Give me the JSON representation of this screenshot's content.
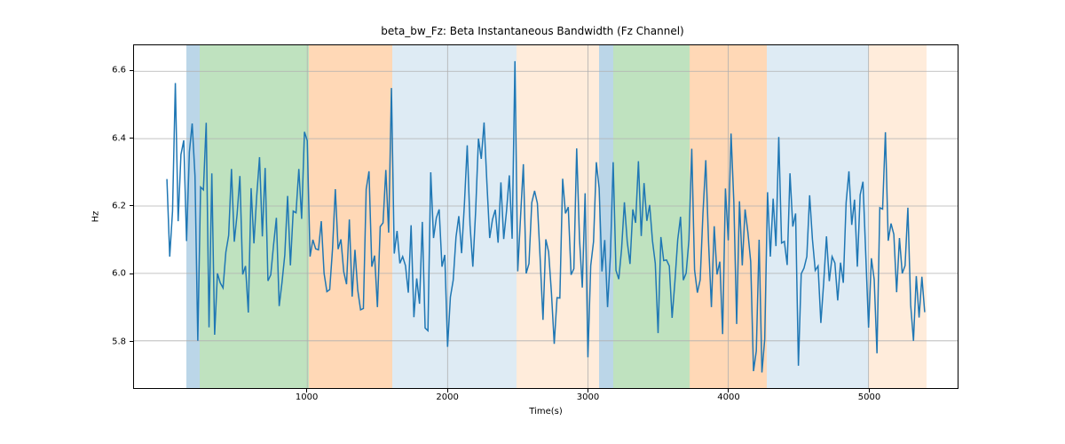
{
  "chart_data": {
    "type": "line",
    "title": "beta_bw_Fz: Beta Instantaneous Bandwidth (Fz Channel)",
    "xlabel": "Time(s)",
    "ylabel": "Hz",
    "xlim": [
      -234.5,
      5634.5
    ],
    "ylim": [
      5.6598,
      6.677
    ],
    "xticks": [
      1000,
      2000,
      3000,
      4000,
      5000
    ],
    "yticks": [
      5.8,
      6.0,
      6.2,
      6.4,
      6.6
    ],
    "spans": [
      {
        "x0": 140,
        "x1": 232,
        "color": "#1f77b4",
        "alpha": 0.3
      },
      {
        "x0": 232,
        "x1": 1008,
        "color": "#2ca02c",
        "alpha": 0.3
      },
      {
        "x0": 1008,
        "x1": 1604,
        "color": "#ff7f0e",
        "alpha": 0.3
      },
      {
        "x0": 1604,
        "x1": 2484,
        "color": "#1f77b4",
        "alpha": 0.15
      },
      {
        "x0": 2484,
        "x1": 3072,
        "color": "#ff7f0e",
        "alpha": 0.15
      },
      {
        "x0": 3072,
        "x1": 3176,
        "color": "#1f77b4",
        "alpha": 0.3
      },
      {
        "x0": 3176,
        "x1": 3716,
        "color": "#2ca02c",
        "alpha": 0.3
      },
      {
        "x0": 3716,
        "x1": 4264,
        "color": "#ff7f0e",
        "alpha": 0.3
      },
      {
        "x0": 4264,
        "x1": 4988,
        "color": "#1f77b4",
        "alpha": 0.15
      },
      {
        "x0": 4988,
        "x1": 5400,
        "color": "#ff7f0e",
        "alpha": 0.15
      }
    ],
    "x": [
      0,
      20,
      40,
      60,
      80,
      100,
      120,
      140,
      160,
      180,
      200,
      220,
      240,
      260,
      280,
      300,
      320,
      340,
      360,
      380,
      400,
      420,
      440,
      460,
      480,
      500,
      520,
      540,
      560,
      580,
      600,
      620,
      640,
      660,
      680,
      700,
      720,
      740,
      760,
      780,
      800,
      820,
      840,
      860,
      880,
      900,
      920,
      940,
      960,
      980,
      1000,
      1020,
      1040,
      1060,
      1080,
      1100,
      1120,
      1140,
      1160,
      1180,
      1200,
      1220,
      1240,
      1260,
      1280,
      1300,
      1320,
      1340,
      1360,
      1380,
      1400,
      1420,
      1440,
      1460,
      1480,
      1500,
      1520,
      1540,
      1560,
      1580,
      1600,
      1620,
      1640,
      1660,
      1680,
      1700,
      1720,
      1740,
      1760,
      1780,
      1800,
      1820,
      1840,
      1860,
      1880,
      1900,
      1920,
      1940,
      1960,
      1980,
      2000,
      2020,
      2040,
      2060,
      2080,
      2100,
      2120,
      2140,
      2160,
      2180,
      2200,
      2220,
      2240,
      2260,
      2280,
      2300,
      2320,
      2340,
      2360,
      2380,
      2400,
      2420,
      2440,
      2460,
      2480,
      2500,
      2520,
      2540,
      2560,
      2580,
      2600,
      2620,
      2640,
      2660,
      2680,
      2700,
      2720,
      2740,
      2760,
      2780,
      2800,
      2820,
      2840,
      2860,
      2880,
      2900,
      2920,
      2940,
      2960,
      2980,
      3000,
      3020,
      3040,
      3060,
      3080,
      3100,
      3120,
      3140,
      3160,
      3180,
      3200,
      3220,
      3240,
      3260,
      3280,
      3300,
      3320,
      3340,
      3360,
      3380,
      3400,
      3420,
      3440,
      3460,
      3480,
      3500,
      3520,
      3540,
      3560,
      3580,
      3600,
      3620,
      3640,
      3660,
      3680,
      3700,
      3720,
      3740,
      3760,
      3780,
      3800,
      3820,
      3840,
      3860,
      3880,
      3900,
      3920,
      3940,
      3960,
      3980,
      4000,
      4020,
      4040,
      4060,
      4080,
      4100,
      4120,
      4140,
      4160,
      4180,
      4200,
      4220,
      4240,
      4260,
      4280,
      4300,
      4320,
      4340,
      4360,
      4380,
      4400,
      4420,
      4440,
      4460,
      4480,
      4500,
      4520,
      4540,
      4560,
      4580,
      4600,
      4620,
      4640,
      4660,
      4680,
      4700,
      4720,
      4740,
      4760,
      4780,
      4800,
      4820,
      4840,
      4860,
      4880,
      4900,
      4920,
      4940,
      4960,
      4980,
      5000,
      5020,
      5040,
      5060,
      5080,
      5100,
      5120,
      5140,
      5160,
      5180,
      5200,
      5220,
      5240,
      5260,
      5280,
      5300,
      5320,
      5340,
      5360,
      5380,
      5400
    ],
    "y": [
      6.28,
      6.05,
      6.185,
      6.565,
      6.155,
      6.353,
      6.395,
      6.096,
      6.36,
      6.445,
      6.29,
      5.8,
      6.256,
      6.248,
      6.447,
      5.84,
      6.297,
      5.818,
      6.0,
      5.972,
      5.957,
      6.063,
      6.113,
      6.31,
      6.094,
      6.175,
      6.289,
      5.997,
      6.022,
      5.884,
      6.253,
      6.089,
      6.23,
      6.345,
      6.11,
      6.313,
      5.978,
      5.996,
      6.085,
      6.165,
      5.903,
      5.973,
      6.055,
      6.23,
      6.024,
      6.185,
      6.18,
      6.31,
      6.162,
      6.42,
      6.394,
      6.05,
      6.1,
      6.073,
      6.07,
      6.155,
      6.0,
      5.946,
      5.952,
      6.072,
      6.25,
      6.072,
      6.101,
      6.005,
      5.968,
      6.16,
      5.931,
      6.07,
      5.95,
      5.892,
      5.896,
      6.25,
      6.303,
      6.02,
      6.053,
      5.9,
      6.139,
      6.15,
      6.307,
      6.121,
      6.55,
      6.059,
      6.126,
      6.03,
      6.05,
      6.023,
      5.943,
      6.143,
      5.87,
      5.985,
      5.91,
      6.153,
      5.838,
      5.83,
      6.3,
      6.105,
      6.165,
      6.19,
      6.02,
      6.055,
      5.782,
      5.93,
      5.98,
      6.108,
      6.17,
      6.06,
      6.207,
      6.38,
      6.144,
      6.02,
      6.185,
      6.4,
      6.34,
      6.448,
      6.27,
      6.105,
      6.16,
      6.189,
      6.091,
      6.27,
      6.102,
      6.185,
      6.291,
      6.103,
      6.63,
      6.006,
      6.168,
      6.324,
      6.0,
      6.029,
      6.21,
      6.245,
      6.208,
      6.041,
      5.862,
      6.101,
      6.064,
      5.943,
      5.791,
      5.928,
      5.927,
      6.281,
      6.178,
      6.197,
      5.996,
      6.014,
      6.371,
      6.103,
      5.958,
      6.238,
      5.751,
      6.023,
      6.094,
      6.33,
      6.253,
      6.006,
      6.099,
      5.9,
      6.05,
      6.33,
      6.009,
      5.983,
      6.073,
      6.211,
      6.095,
      6.028,
      6.19,
      6.15,
      6.333,
      6.111,
      6.268,
      6.156,
      6.203,
      6.097,
      6.03,
      5.823,
      6.108,
      6.038,
      6.04,
      6.022,
      5.868,
      5.976,
      6.1,
      6.168,
      5.98,
      6.001,
      6.1,
      6.37,
      6.01,
      5.943,
      5.981,
      6.18,
      6.336,
      6.09,
      5.9,
      6.14,
      5.997,
      6.035,
      5.82,
      6.252,
      6.098,
      6.415,
      6.21,
      5.85,
      6.214,
      6.024,
      6.19,
      6.122,
      6.035,
      5.71,
      5.77,
      6.1,
      5.706,
      5.805,
      6.241,
      6.05,
      6.222,
      6.081,
      6.405,
      6.09,
      6.095,
      6.025,
      6.297,
      6.139,
      6.178,
      5.726,
      5.999,
      6.016,
      6.05,
      6.232,
      6.101,
      6.009,
      6.022,
      5.853,
      5.972,
      6.11,
      5.977,
      6.05,
      6.031,
      5.92,
      6.032,
      5.972,
      6.21,
      6.303,
      6.144,
      6.219,
      6.02,
      6.233,
      6.272,
      6.055,
      5.839,
      6.045,
      5.982,
      5.763,
      6.195,
      6.191,
      6.419,
      6.097,
      6.148,
      6.116,
      5.944,
      6.105,
      6.0,
      6.023,
      6.195,
      5.906,
      5.8,
      5.992,
      5.869,
      5.99,
      5.885
    ],
    "line_color": "#1f77b4"
  }
}
